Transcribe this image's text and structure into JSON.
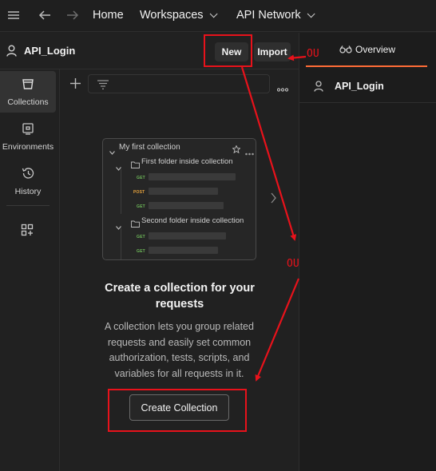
{
  "topbar": {
    "home": "Home",
    "workspaces": "Workspaces",
    "api_network": "API Network"
  },
  "workspace": {
    "name": "API_Login",
    "new_label": "New",
    "import_label": "Import"
  },
  "right_pane": {
    "overview_tab": "Overview",
    "item_name": "API_Login"
  },
  "nav": {
    "items": [
      {
        "label": "Collections",
        "icon": "trash-bin-icon",
        "active": true
      },
      {
        "label": "Environments",
        "icon": "environment-icon",
        "active": false
      },
      {
        "label": "History",
        "icon": "history-icon",
        "active": false
      },
      {
        "label": "",
        "icon": "add-apps-icon",
        "active": false
      }
    ]
  },
  "illustration": {
    "title": "My first collection",
    "folder1": "First folder inside collection",
    "folder2": "Second folder inside collection",
    "methods": [
      "GET",
      "POST",
      "GET",
      "GET",
      "GET"
    ]
  },
  "empty_state": {
    "title": "Create a collection for your requests",
    "description": "A collection lets you group related requests and easily set common authorization, tests, scripts, and variables for all requests in it.",
    "create_label": "Create Collection"
  },
  "annotations": {
    "ou1": "OU",
    "ou2": "OU",
    "color": "#e8121b"
  }
}
